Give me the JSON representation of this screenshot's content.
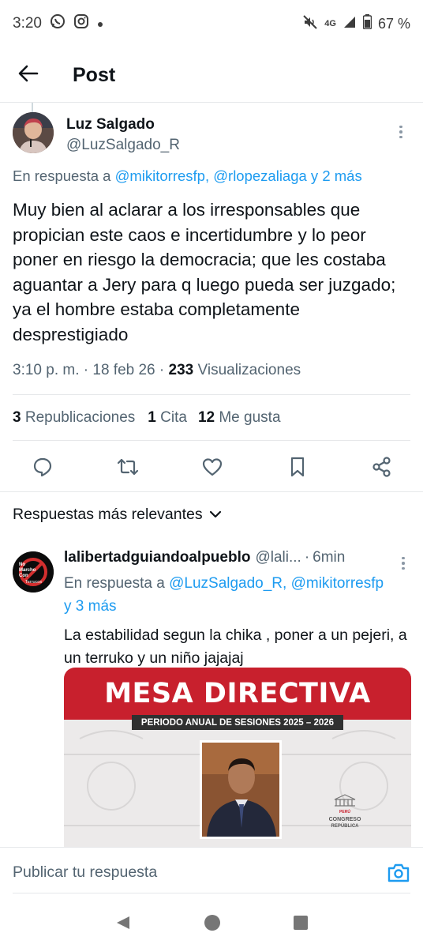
{
  "status_bar": {
    "time": "3:20",
    "network": "4G",
    "battery": "67 %",
    "icons": [
      "whatsapp-icon",
      "instagram-icon",
      "dot-icon",
      "mute-icon",
      "signal-icon",
      "battery-icon"
    ]
  },
  "header": {
    "title": "Post",
    "back_icon": "arrow-left-icon"
  },
  "post": {
    "author_name": "Luz Salgado",
    "author_handle": "@LuzSalgado_R",
    "reply_prefix": "En respuesta a ",
    "reply_links": "@mikitorresfp, @rlopezaliaga y 2 más",
    "text": "Muy bien al aclarar a los irresponsables que propician este caos e incertidumbre y lo peor poner en riesgo la democracia; que les costaba aguantar a Jery para q luego pueda ser juzgado; ya el hombre estaba completamente desprestigiado",
    "time": "3:10 p. m.",
    "date": "18 feb 26",
    "views_count": "233",
    "views_label": "Visualizaciones",
    "reposts_count": "3",
    "reposts_label": "Republicaciones",
    "quotes_count": "1",
    "quotes_label": "Cita",
    "likes_count": "12",
    "likes_label": "Me gusta"
  },
  "actions": [
    "reply-icon",
    "repost-icon",
    "like-icon",
    "bookmark-icon",
    "share-icon"
  ],
  "replies_filter": {
    "label": "Respuestas más relevantes"
  },
  "reply": {
    "author_name": "lalibertadguiandoalpueblo",
    "author_handle": "@lali...",
    "time": "6min",
    "reply_prefix": "En respuesta a ",
    "reply_links_line1": "@LuzSalgado_R, @mikitorresfp",
    "reply_links_line2": "y 3 más",
    "text": "La estabilidad segun la chika , poner a un pejeri, a un terruko y un niño jajajaj",
    "avatar_text_1": "No",
    "avatar_text_2": "Marcho",
    "avatar_text_3": "Con",
    "avatar_text_4": "Terrucos",
    "media": {
      "title": "MESA DIRECTIVA",
      "subtitle": "PERIODO ANUAL DE SESIONES 2025 – 2026",
      "logo_line1": "PERÚ",
      "logo_line2": "CONGRESO",
      "logo_line3": "REPÚBLICA"
    }
  },
  "compose": {
    "placeholder": "Publicar tu respuesta"
  },
  "colors": {
    "accent": "#1d9bf0",
    "text_primary": "#0f1419",
    "text_secondary": "#536471",
    "banner_red": "#c8202d"
  }
}
